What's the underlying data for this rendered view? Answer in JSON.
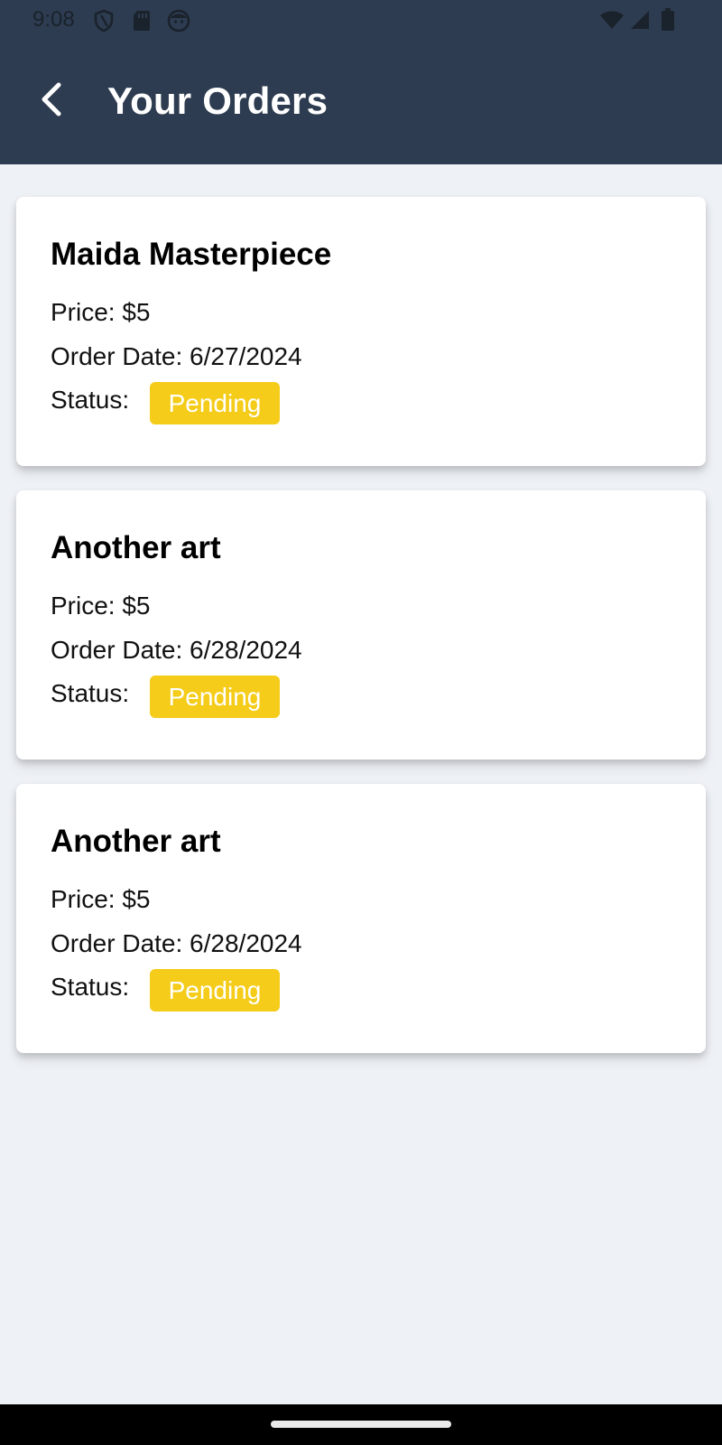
{
  "status_bar": {
    "time": "9:08",
    "left_icons": [
      "shield-icon",
      "sim-card-icon",
      "face-icon"
    ],
    "right_icons": [
      "wifi-icon",
      "signal-icon",
      "battery-icon"
    ]
  },
  "header": {
    "back_icon": "back-arrow-icon",
    "title": "Your Orders",
    "background_color": "#2d3c50"
  },
  "orders": [
    {
      "title": "Maida Masterpiece",
      "price": "Price: $5",
      "order_date": "Order Date: 6/27/2024",
      "status_label": "Status:",
      "status": "Pending"
    },
    {
      "title": "Another art",
      "price": "Price: $5",
      "order_date": "Order Date: 6/28/2024",
      "status_label": "Status:",
      "status": "Pending"
    },
    {
      "title": "Another art",
      "price": "Price: $5",
      "order_date": "Order Date: 6/28/2024",
      "status_label": "Status:",
      "status": "Pending"
    }
  ],
  "colors": {
    "page_background": "#eef1f6",
    "card_background": "#ffffff",
    "pending_badge": "#f4cc19",
    "badge_text": "#ffffff"
  }
}
